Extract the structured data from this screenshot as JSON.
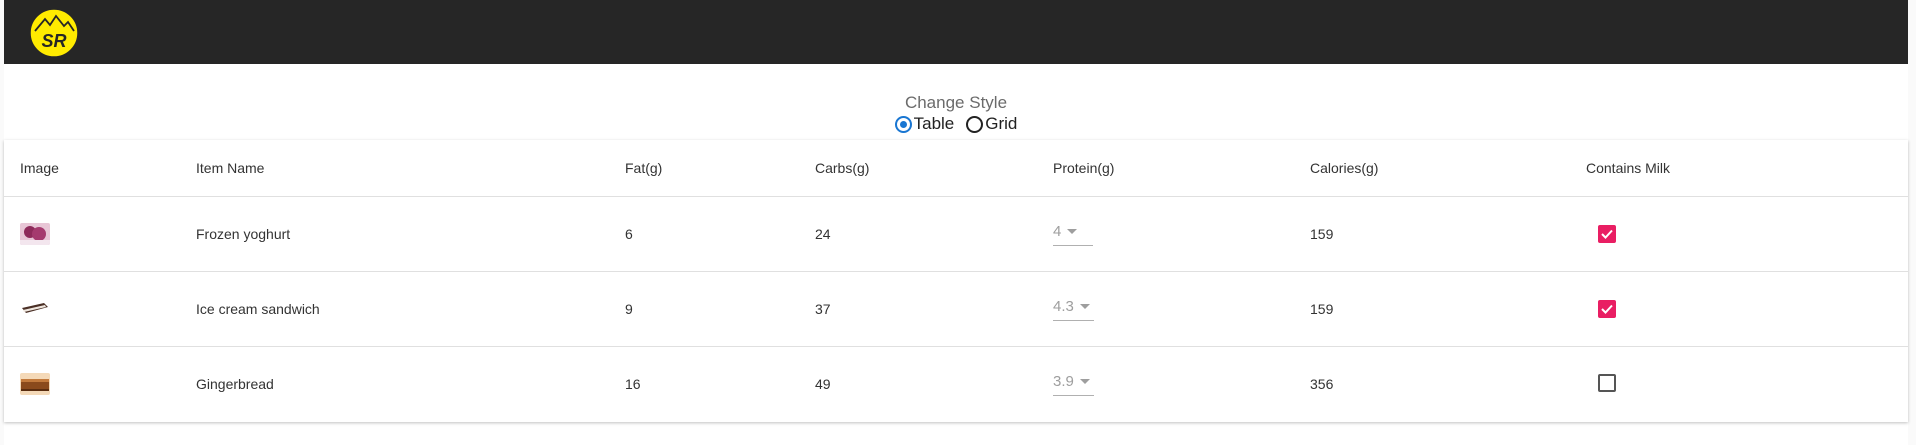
{
  "app": {
    "logo_text": "SR",
    "logo_color": "#ffeb00",
    "topbar_color": "#262626"
  },
  "style_switch": {
    "title": "Change Style",
    "options": [
      {
        "label": "Table",
        "selected": true
      },
      {
        "label": "Grid",
        "selected": false
      }
    ]
  },
  "table": {
    "headers": [
      "Image",
      "Item Name",
      "Fat(g)",
      "Carbs(g)",
      "Protein(g)",
      "Calories(g)",
      "Contains Milk"
    ],
    "rows": [
      {
        "image": "frozen-yoghurt-thumbnail",
        "name": "Frozen yoghurt",
        "fat": "6",
        "carbs": "24",
        "protein": "4",
        "calories": "159",
        "contains_milk": true
      },
      {
        "image": "ice-cream-sandwich-thumbnail",
        "name": "Ice cream sandwich",
        "fat": "9",
        "carbs": "37",
        "protein": "4.3",
        "calories": "159",
        "contains_milk": true
      },
      {
        "image": "gingerbread-thumbnail",
        "name": "Gingerbread",
        "fat": "16",
        "carbs": "49",
        "protein": "3.9",
        "calories": "356",
        "contains_milk": false
      }
    ],
    "checkbox_color": "#e91e63"
  }
}
